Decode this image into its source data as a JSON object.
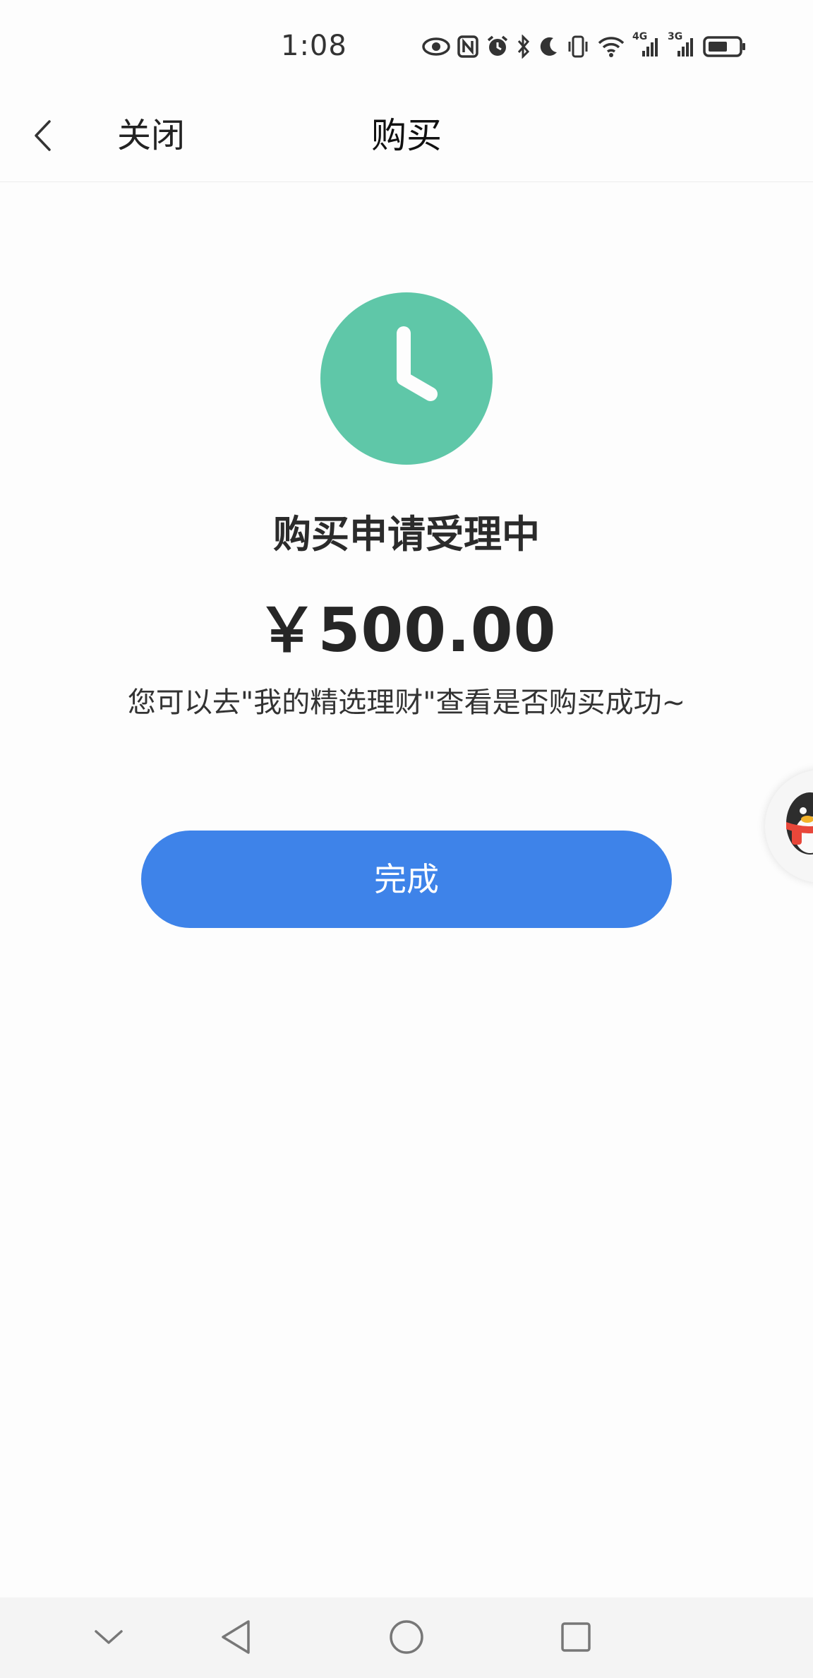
{
  "status_bar": {
    "time": "1:08",
    "icons": [
      "eye-icon",
      "nfc-icon",
      "alarm-icon",
      "bluetooth-icon",
      "moon-icon",
      "vibrate-icon",
      "wifi-icon",
      "signal-4g-icon",
      "signal-3g-icon",
      "battery-icon"
    ],
    "network_labels": [
      "4G",
      "3G"
    ]
  },
  "header": {
    "back_icon": "chevron-left-icon",
    "close_label": "关闭",
    "title": "购买"
  },
  "result": {
    "icon": "clock-icon",
    "icon_color": "#5fc7a8",
    "title": "购买申请受理中",
    "amount": "￥500.00",
    "hint": "您可以去\"我的精选理财\"查看是否购买成功~"
  },
  "actions": {
    "done_label": "完成",
    "done_color": "#3e83e9"
  },
  "floating_widget": {
    "icon": "qq-penguin-icon"
  },
  "nav_bar": {
    "buttons": [
      "chevron-down-icon",
      "back-triangle-icon",
      "home-circle-icon",
      "recents-square-icon"
    ]
  }
}
